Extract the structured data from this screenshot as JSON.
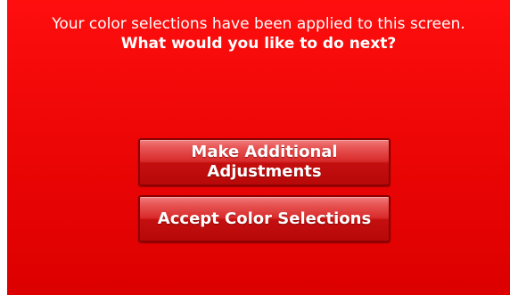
{
  "dialog": {
    "message_line1": "Your color selections have been applied to this screen.",
    "message_line2": "What would you like to do next?"
  },
  "buttons": {
    "adjust_label": "Make Additional Adjustments",
    "accept_label": "Accept Color Selections"
  },
  "colors": {
    "background": "#e60303",
    "button_border": "#8a0000",
    "text": "#ffffff"
  }
}
